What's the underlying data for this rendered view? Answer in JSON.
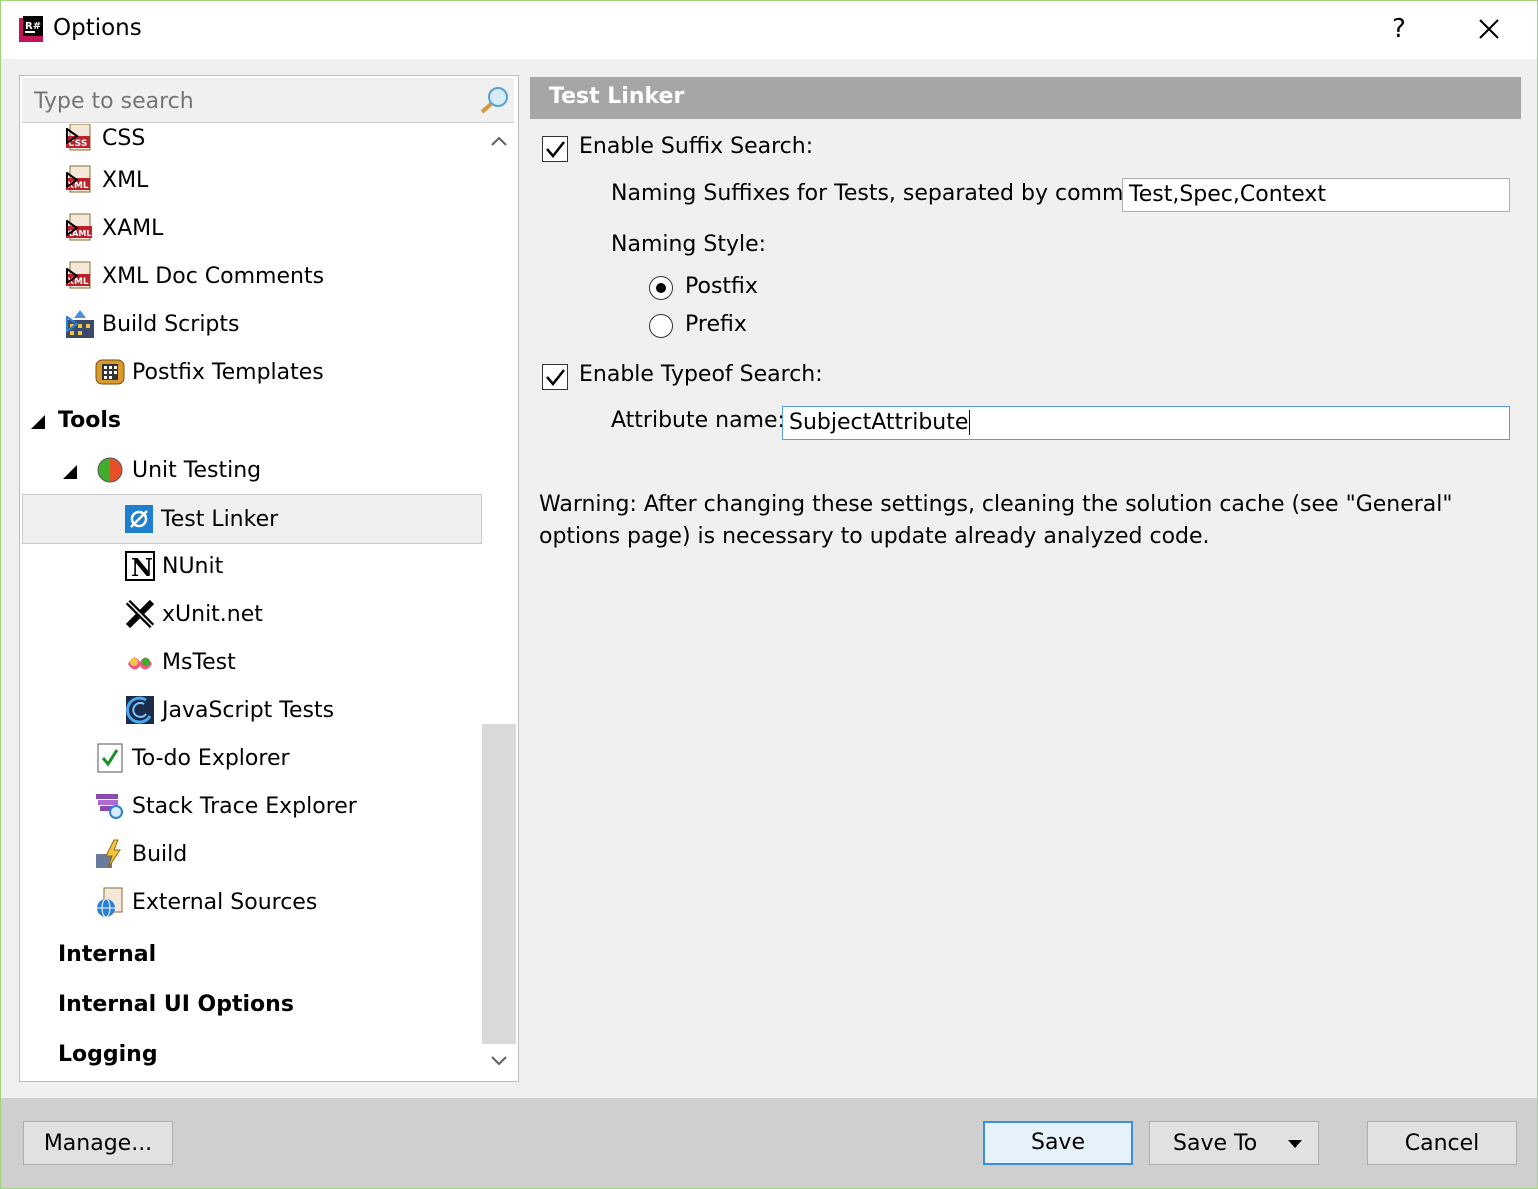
{
  "window": {
    "title": "Options",
    "help_label": "?"
  },
  "search": {
    "placeholder": "Type to search"
  },
  "tree": {
    "items": [
      {
        "label": "CSS",
        "icon": "css-file-icon"
      },
      {
        "label": "XML",
        "icon": "xml-file-icon"
      },
      {
        "label": "XAML",
        "icon": "xaml-file-icon"
      },
      {
        "label": "XML Doc Comments",
        "icon": "xml-doc-icon"
      },
      {
        "label": "Build Scripts",
        "icon": "build-scripts-icon"
      },
      {
        "label": "Postfix Templates",
        "icon": "postfix-templates-icon"
      },
      {
        "label": "Tools",
        "icon": ""
      },
      {
        "label": "Unit Testing",
        "icon": "unit-testing-icon"
      },
      {
        "label": "Test Linker",
        "icon": "test-linker-icon",
        "selected": true
      },
      {
        "label": "NUnit",
        "icon": "nunit-icon"
      },
      {
        "label": "xUnit.net",
        "icon": "xunit-icon"
      },
      {
        "label": "MsTest",
        "icon": "mstest-icon"
      },
      {
        "label": "JavaScript Tests",
        "icon": "javascript-tests-icon"
      },
      {
        "label": "To-do Explorer",
        "icon": "todo-explorer-icon"
      },
      {
        "label": "Stack Trace Explorer",
        "icon": "stack-trace-icon"
      },
      {
        "label": "Build",
        "icon": "build-icon"
      },
      {
        "label": "External Sources",
        "icon": "external-sources-icon"
      },
      {
        "label": "Internal",
        "icon": ""
      },
      {
        "label": "Internal UI Options",
        "icon": ""
      },
      {
        "label": "Logging",
        "icon": ""
      }
    ]
  },
  "page": {
    "header": "Test Linker",
    "enable_suffix_label": "Enable Suffix Search:",
    "enable_suffix_checked": true,
    "suffixes_label": "Naming Suffixes for Tests, separated by comma:",
    "suffixes_value": "Test,Spec,Context",
    "naming_style_label": "Naming Style:",
    "postfix_label": "Postfix",
    "prefix_label": "Prefix",
    "naming_style_selected": "Postfix",
    "enable_typeof_label": "Enable Typeof Search:",
    "enable_typeof_checked": true,
    "attribute_label": "Attribute name:",
    "attribute_value": "SubjectAttribute",
    "warning": "Warning: After changing these settings, cleaning the solution cache (see \"General\" options page) is necessary to update already analyzed code."
  },
  "footer": {
    "manage_label": "Manage...",
    "save_label": "Save",
    "save_to_label": "Save To",
    "cancel_label": "Cancel"
  },
  "colors": {
    "header_bg": "#a6a6a6",
    "default_button_border": "#3c8ed8",
    "window_border": "#a3d37c"
  }
}
